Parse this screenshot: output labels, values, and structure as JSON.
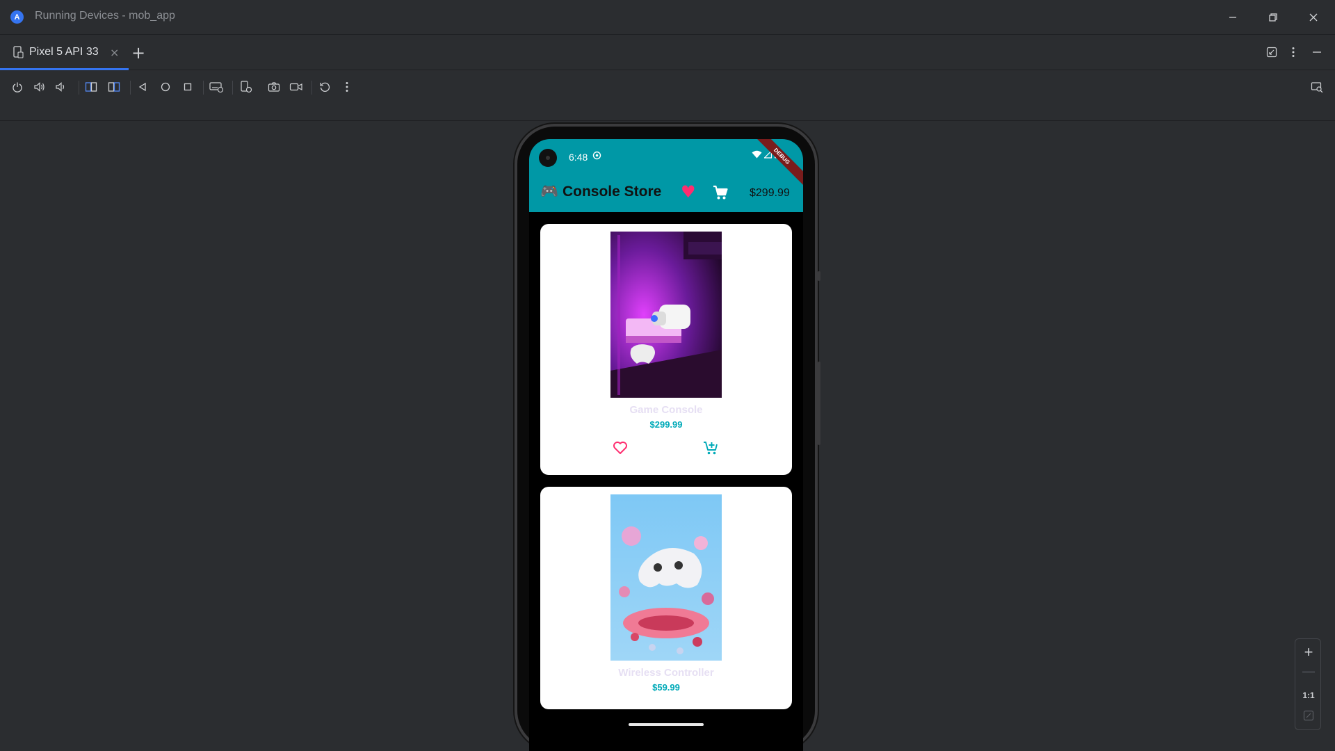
{
  "window": {
    "title": "Running Devices - mob_app",
    "logo_letter": "A"
  },
  "tabs": [
    {
      "label": "Pixel 5 API 33"
    }
  ],
  "zoom": {
    "fit_label": "1:1"
  },
  "device": {
    "status_time": "6:48",
    "debug_banner": "DEBUG",
    "app_title": "🎮 Console Store",
    "cart_total": "$299.99"
  },
  "products": [
    {
      "name": "Game Console",
      "price": "$299.99"
    },
    {
      "name": "Wireless Controller",
      "price": "$59.99"
    }
  ],
  "colors": {
    "accent": "#3574f0",
    "app_bar": "#0098a6",
    "favorite": "#ff2d6f",
    "price": "#00aab8"
  }
}
